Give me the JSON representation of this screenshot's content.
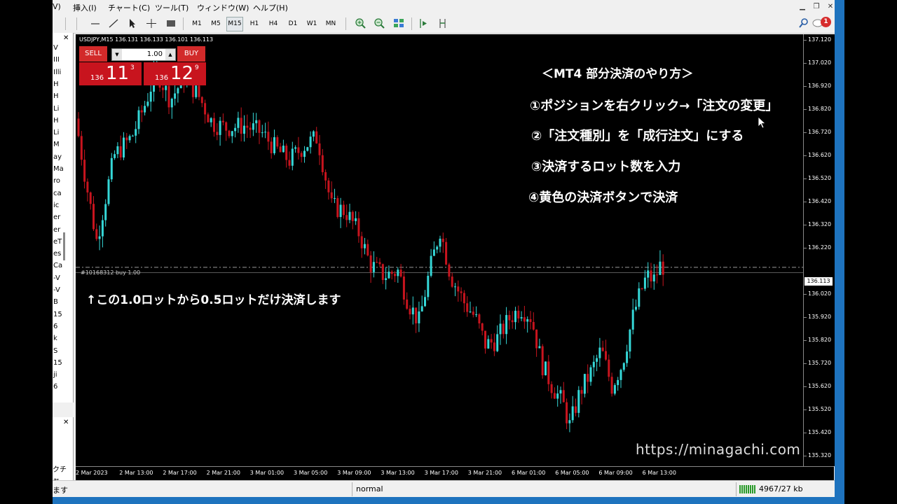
{
  "menu": {
    "items": [
      "V)",
      "挿入(I)",
      "チャート(C)",
      "ツール(T)",
      "ウィンドウ(W)",
      "ヘルプ(H)"
    ]
  },
  "toolbar": {
    "timeframes": [
      "M1",
      "M5",
      "M15",
      "H1",
      "H4",
      "D1",
      "W1",
      "MN"
    ],
    "active_timeframe": "M15"
  },
  "alerts": {
    "count": "1"
  },
  "navigator": {
    "labels": [
      "V",
      "III",
      "Illi",
      "H",
      "H",
      "Li",
      "H",
      "Li",
      "M",
      "ay",
      "Ma",
      "ro",
      "ca",
      "ic",
      "er",
      "er",
      "eT",
      "es",
      "Ca",
      "-V",
      "-V",
      "B",
      "15",
      "6",
      "k",
      "S",
      "15",
      "ji",
      "6"
    ],
    "bottom_label": "クチャ"
  },
  "chart": {
    "symbol_line": "USDJPY,M15  136.131 136.133 136.101 136.113",
    "current_price": "136.113",
    "order_label": "#10168312 buy 1.00",
    "y_ticks": [
      "137.120",
      "137.020",
      "136.920",
      "136.820",
      "136.720",
      "136.620",
      "136.520",
      "136.420",
      "136.320",
      "136.220",
      "136.020",
      "135.920",
      "135.820",
      "135.720",
      "135.620",
      "135.520",
      "135.420",
      "135.320"
    ],
    "x_ticks": [
      "2 Mar 2023",
      "2 Mar 13:00",
      "2 Mar 17:00",
      "2 Mar 21:00",
      "3 Mar 01:00",
      "3 Mar 05:00",
      "3 Mar 09:00",
      "3 Mar 13:00",
      "3 Mar 17:00",
      "3 Mar 21:00",
      "6 Mar 01:00",
      "6 Mar 05:00",
      "6 Mar 09:00",
      "6 Mar 13:00"
    ]
  },
  "one_click": {
    "sell_label": "SELL",
    "buy_label": "BUY",
    "lot": "1.00",
    "sell_pre": "136",
    "sell_big": "11",
    "sell_sup": "3",
    "buy_pre": "136",
    "buy_big": "12",
    "buy_sup": "9"
  },
  "annotations": {
    "title": "＜MT4 部分決済のやり方＞",
    "step1": "①ポジションを右クリック→「注文の変更」",
    "step2": "②「注文種別」を「成行注文」にする",
    "step3": "③決済するロット数を入力",
    "step4": "④黄色の決済ボタンで決済",
    "note": "↑この1.0ロットから0.5ロットだけ決済します",
    "watermark": "https://minagachi.com"
  },
  "status": {
    "left": "ます",
    "profile": "normal",
    "traffic": "4967/27 kb"
  },
  "colors": {
    "bull": "#35d7d7",
    "bear": "#c8141e",
    "sell_bg": "#d22a2a"
  }
}
